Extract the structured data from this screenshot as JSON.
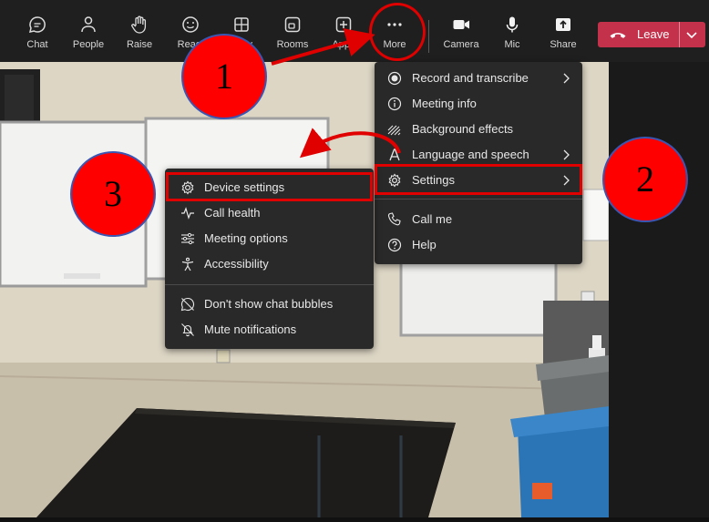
{
  "toolbar": {
    "buttons": [
      {
        "label": "Chat",
        "icon": "chat-icon"
      },
      {
        "label": "People",
        "icon": "people-icon"
      },
      {
        "label": "Raise",
        "icon": "raise-hand-icon"
      },
      {
        "label": "React",
        "icon": "react-icon"
      },
      {
        "label": "View",
        "icon": "view-icon"
      },
      {
        "label": "Rooms",
        "icon": "rooms-icon"
      },
      {
        "label": "Apps",
        "icon": "apps-icon"
      },
      {
        "label": "More",
        "icon": "more-icon"
      },
      {
        "label": "Camera",
        "icon": "camera-icon"
      },
      {
        "label": "Mic",
        "icon": "mic-icon"
      },
      {
        "label": "Share",
        "icon": "share-icon"
      }
    ],
    "leave_label": "Leave",
    "leave_color": "#c4314b"
  },
  "more_menu": {
    "items": [
      {
        "label": "Record and transcribe",
        "icon": "record-icon",
        "submenu": true
      },
      {
        "label": "Meeting info",
        "icon": "info-icon",
        "submenu": false
      },
      {
        "label": "Background effects",
        "icon": "background-effects-icon",
        "submenu": false
      },
      {
        "label": "Language and speech",
        "icon": "language-icon",
        "submenu": true
      },
      {
        "label": "Settings",
        "icon": "gear-icon",
        "submenu": true
      },
      {
        "label": "Call me",
        "icon": "phone-icon",
        "submenu": false
      },
      {
        "label": "Help",
        "icon": "help-icon",
        "submenu": false
      }
    ]
  },
  "settings_menu": {
    "items": [
      {
        "label": "Device settings",
        "icon": "gear-icon"
      },
      {
        "label": "Call health",
        "icon": "pulse-icon"
      },
      {
        "label": "Meeting options",
        "icon": "sliders-icon"
      },
      {
        "label": "Accessibility",
        "icon": "accessibility-icon"
      },
      {
        "label": "Don't show chat bubbles",
        "icon": "chat-bubble-off-icon"
      },
      {
        "label": "Mute notifications",
        "icon": "bell-off-icon"
      }
    ]
  },
  "annotations": {
    "step1": "1",
    "step2": "2",
    "step3": "3",
    "color": "#ff0000"
  }
}
